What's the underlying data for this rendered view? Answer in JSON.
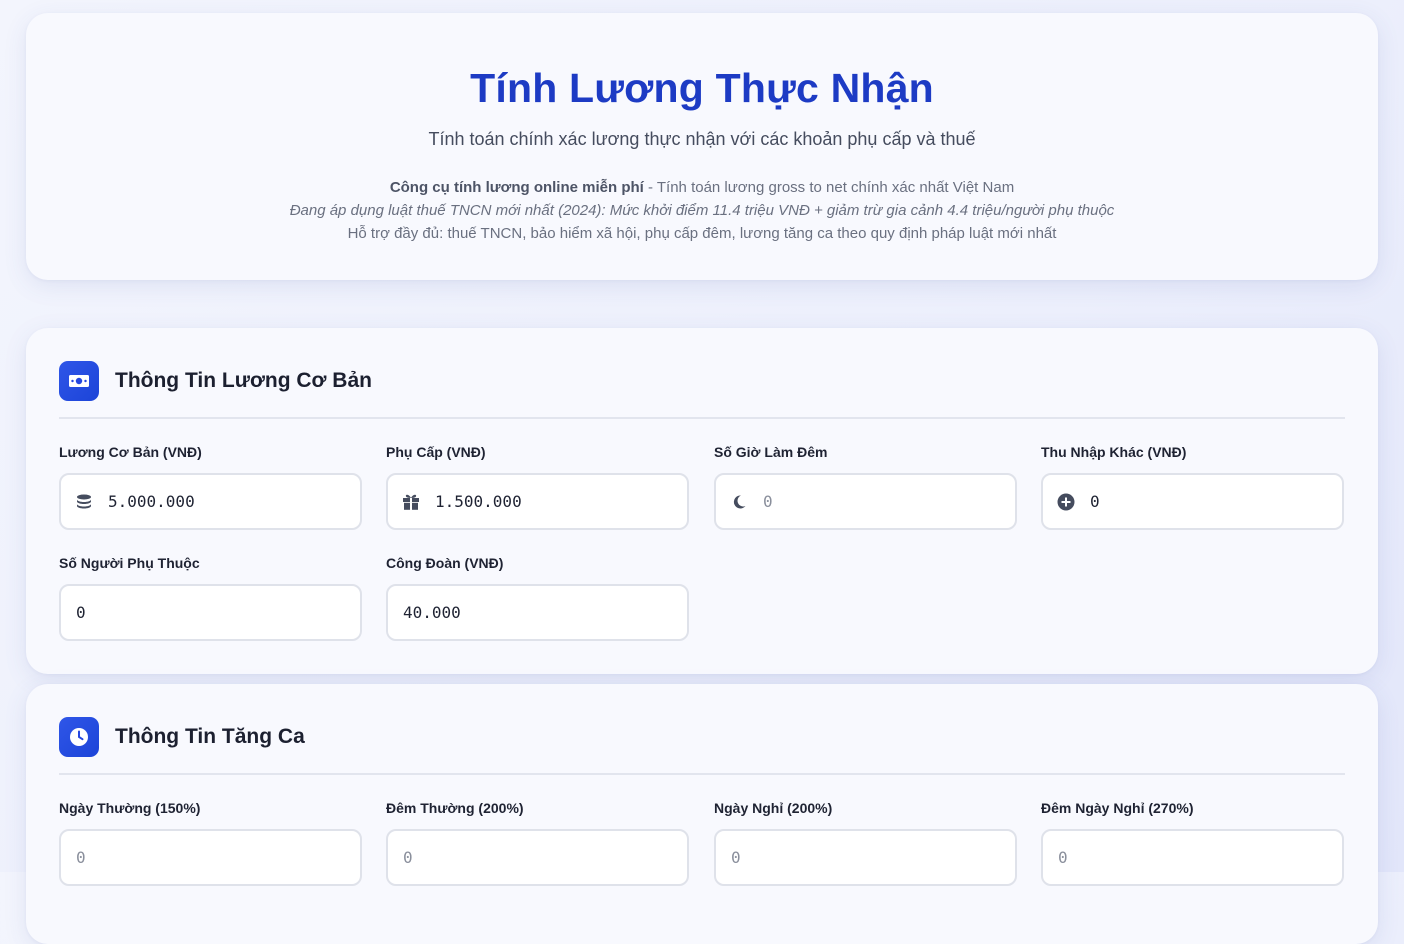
{
  "hero": {
    "title": "Tính Lương Thực Nhận",
    "subtitle": "Tính toán chính xác lương thực nhận với các khoản phụ cấp và thuế",
    "line1_bold": "Công cụ tính lương online miễn phí",
    "line1_rest": " - Tính toán lương gross to net chính xác nhất Việt Nam",
    "line2": "Đang áp dụng luật thuế TNCN mới nhất (2024): Mức khởi điểm 11.4 triệu VNĐ + giảm trừ gia cảnh 4.4 triệu/người phụ thuộc",
    "line3": "Hỗ trợ đầy đủ: thuế TNCN, bảo hiểm xã hội, phụ cấp đêm, lương tăng ca theo quy định pháp luật mới nhất"
  },
  "basic": {
    "title": "Thông Tin Lương Cơ Bản",
    "icon": "money-icon",
    "fields": [
      {
        "label": "Lương Cơ Bản (VNĐ)",
        "value": "5.000.000",
        "placeholder": "",
        "icon": "coins-icon"
      },
      {
        "label": "Phụ Cấp (VNĐ)",
        "value": "1.500.000",
        "placeholder": "",
        "icon": "gift-icon"
      },
      {
        "label": "Số Giờ Làm Đêm",
        "value": "",
        "placeholder": "0",
        "icon": "moon-icon"
      },
      {
        "label": "Thu Nhập Khác (VNĐ)",
        "value": "0",
        "placeholder": "",
        "icon": "plus-circle-icon"
      },
      {
        "label": "Số Người Phụ Thuộc",
        "value": "0",
        "placeholder": ""
      },
      {
        "label": "Công Đoàn (VNĐ)",
        "value": "40.000",
        "placeholder": ""
      }
    ]
  },
  "overtime": {
    "title": "Thông Tin Tăng Ca",
    "icon": "clock-icon",
    "fields": [
      {
        "label": "Ngày Thường (150%)",
        "value": "",
        "placeholder": "0"
      },
      {
        "label": "Đêm Thường (200%)",
        "value": "",
        "placeholder": "0"
      },
      {
        "label": "Ngày Nghỉ (200%)",
        "value": "",
        "placeholder": "0"
      },
      {
        "label": "Đêm Ngày Nghỉ (270%)",
        "value": "",
        "placeholder": "0"
      }
    ]
  },
  "colors": {
    "accent": "#1d3bc4",
    "icon_bg": "#2447e0",
    "border": "#dfe2ea"
  }
}
